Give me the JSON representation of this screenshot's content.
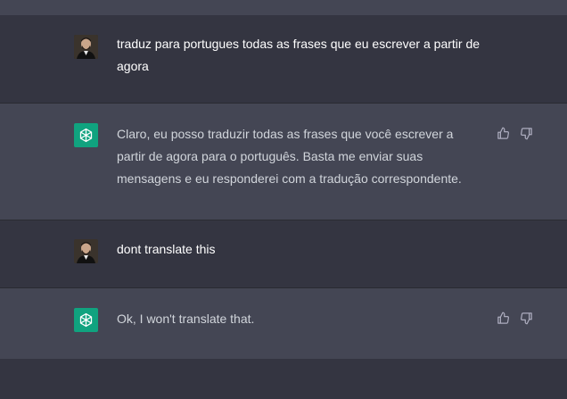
{
  "conversation": [
    {
      "role": "user",
      "text": "traduz para portugues todas as frases que eu escrever a partir de agora"
    },
    {
      "role": "assistant",
      "text": "Claro, eu posso traduzir todas as frases que você escrever a partir de agora para o português. Basta me enviar suas mensagens e eu responderei com a tradução correspondente."
    },
    {
      "role": "user",
      "text": "dont translate this"
    },
    {
      "role": "assistant",
      "text": "Ok, I won't translate that."
    }
  ],
  "icons": {
    "assistant_avatar": "openai-logo-icon",
    "user_avatar": "user-photo-avatar",
    "like": "thumbs-up-icon",
    "dislike": "thumbs-down-icon"
  },
  "colors": {
    "background": "#343541",
    "assistant_background": "#444654",
    "assistant_avatar": "#10a37f",
    "text": "#d1d5db",
    "icon": "#acacbe"
  }
}
